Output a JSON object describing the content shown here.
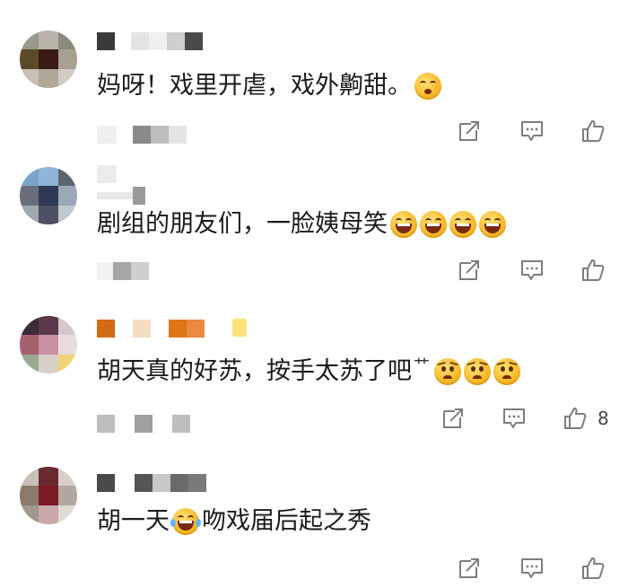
{
  "comments": [
    {
      "text_parts": [
        "妈呀！戏里开虐，戏外齁甜。"
      ],
      "emojis": [
        "shy"
      ],
      "like_count": ""
    },
    {
      "text_parts": [
        "剧组的朋友们，一脸姨母笑"
      ],
      "emojis": [
        "grin",
        "grin",
        "grin",
        "grin"
      ],
      "like_count": ""
    },
    {
      "text_parts": [
        "胡天真的好苏，按手太苏了吧",
        "艹"
      ],
      "emojis": [
        "sad",
        "sad",
        "sad"
      ],
      "like_count": "8"
    },
    {
      "text_parts": [
        "胡一天",
        "吻戏届后起之秀"
      ],
      "emojis": [
        "laugh"
      ],
      "like_count": ""
    }
  ],
  "icons": {
    "repost": "repost-icon",
    "comment": "comment-icon",
    "like": "like-icon"
  },
  "colors": {
    "text": "#1a1a1a",
    "icon": "#7d7d7d",
    "emoji": "#f5b21c"
  }
}
